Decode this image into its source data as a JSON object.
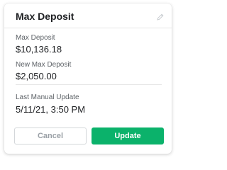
{
  "dialog": {
    "title": "Max Deposit",
    "edit_icon": "pencil-icon"
  },
  "fields": {
    "max_deposit": {
      "label": "Max Deposit",
      "value": "$10,136.18"
    },
    "new_max_deposit": {
      "label": "New Max Deposit",
      "value": "$2,050.00"
    },
    "last_manual_update": {
      "label": "Last Manual Update",
      "value": "5/11/21, 3:50 PM"
    }
  },
  "actions": {
    "cancel_label": "Cancel",
    "update_label": "Update"
  },
  "colors": {
    "primary": "#0bb26b",
    "divider": "#e6e6e6"
  }
}
